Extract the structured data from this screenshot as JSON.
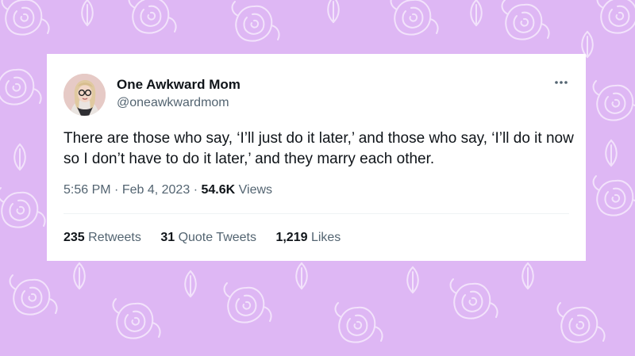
{
  "colors": {
    "background": "#deb7f4",
    "card": "#ffffff",
    "text_primary": "#0f1419",
    "text_secondary": "#536471"
  },
  "tweet": {
    "author_name": "One Awkward Mom",
    "author_handle": "@oneawkwardmom",
    "text": "There are those who say, ‘I’ll just do it later,’ and those who say, ‘I’ll do it now so I don’t have to do it later,’ and they marry each other.",
    "time": "5:56 PM",
    "date": "Feb 4, 2023",
    "separator": "·",
    "views_count": "54.6K",
    "views_label": "Views",
    "more_icon": "more-horizontal-icon"
  },
  "stats": {
    "retweets_count": "235",
    "retweets_label": "Retweets",
    "quote_tweets_count": "31",
    "quote_tweets_label": "Quote Tweets",
    "likes_count": "1,219",
    "likes_label": "Likes"
  }
}
